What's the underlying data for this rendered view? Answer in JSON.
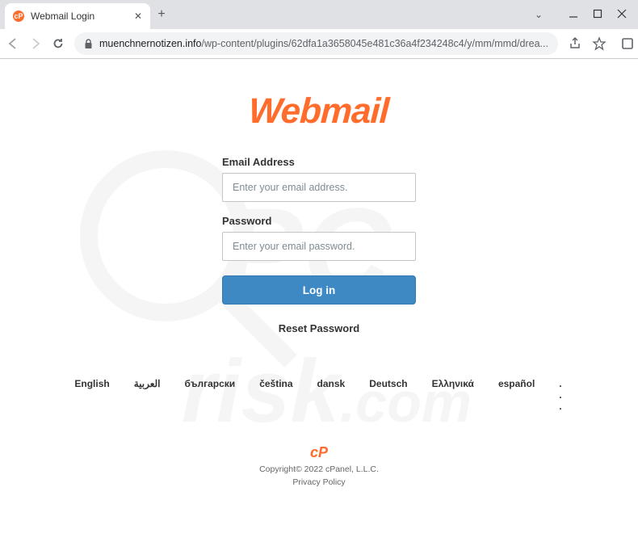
{
  "tab": {
    "title": "Webmail Login"
  },
  "url": {
    "host": "muenchnernotizen.info",
    "path": "/wp-content/plugins/62dfa1a3658045e481c36a4f234248c4/y/mm/mmd/drea..."
  },
  "logo": {
    "text": "Webmail"
  },
  "form": {
    "email_label": "Email Address",
    "email_placeholder": "Enter your email address.",
    "password_label": "Password",
    "password_placeholder": "Enter your email password.",
    "login_label": "Log in",
    "reset_label": "Reset Password"
  },
  "languages": [
    "English",
    "العربية",
    "български",
    "čeština",
    "dansk",
    "Deutsch",
    "Ελληνικά",
    "español"
  ],
  "languages_more": ". . .",
  "footer": {
    "cp_logo": "cP",
    "copyright": "Copyright© 2022 cPanel, L.L.C.",
    "privacy": "Privacy Policy"
  }
}
